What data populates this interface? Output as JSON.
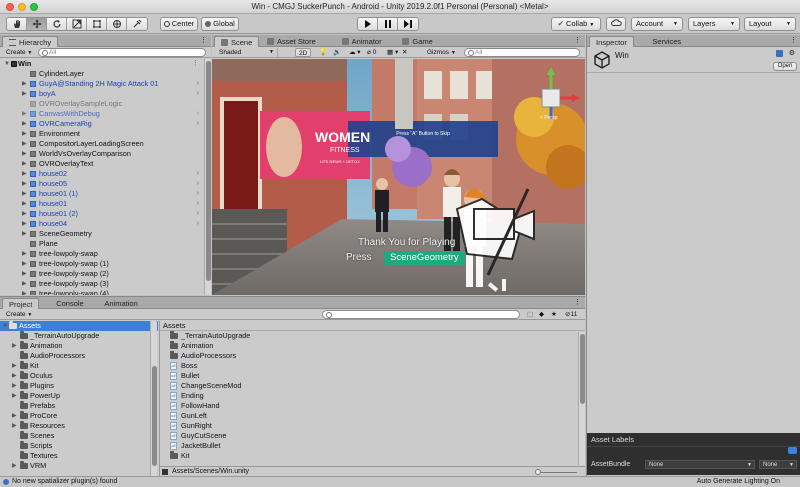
{
  "window": {
    "title": "Win - CMGJ SuckerPunch - Android - Unity 2019.2.0f1 Personal (Personal) <Metal>"
  },
  "toolbar": {
    "tools": [
      "hand-tool-icon",
      "move-tool-icon",
      "rotate-tool-icon",
      "scale-tool-icon",
      "rect-tool-icon",
      "transform-tool-icon",
      "custom-tool-icon"
    ],
    "pivot_label": "Center",
    "space_label": "Global",
    "collab_label": "Collab",
    "account_label": "Account",
    "layers_label": "Layers",
    "layout_label": "Layout"
  },
  "hierarchy": {
    "tab_label": "Hierarchy",
    "create_label": "Create",
    "search_placeholder": "All",
    "root": "Win",
    "items": [
      {
        "label": "CylinderLayer",
        "type": "normal",
        "has_children": false,
        "expand": false
      },
      {
        "label": "GuyA@Standing 2H Magic Attack 01",
        "type": "prefab",
        "has_children": true,
        "expand": true
      },
      {
        "label": "boyA",
        "type": "prefab",
        "has_children": true,
        "expand": true
      },
      {
        "label": "OVROverlaySampleLogic",
        "type": "disabled",
        "has_children": false,
        "expand": false
      },
      {
        "label": "CanvasWithDebug",
        "type": "prefab-disabled",
        "has_children": true,
        "expand": true
      },
      {
        "label": "OVRCameraRig",
        "type": "prefab",
        "has_children": true,
        "expand": true
      },
      {
        "label": "Environment",
        "type": "normal",
        "has_children": true,
        "expand": false
      },
      {
        "label": "CompositorLayerLoadingScreen",
        "type": "normal",
        "has_children": true,
        "expand": false
      },
      {
        "label": "WorldVsOverlayComparison",
        "type": "normal",
        "has_children": true,
        "expand": false
      },
      {
        "label": "OVROverlayText",
        "type": "normal",
        "has_children": true,
        "expand": false
      },
      {
        "label": "house02",
        "type": "prefab",
        "has_children": true,
        "expand": true
      },
      {
        "label": "house05",
        "type": "prefab",
        "has_children": true,
        "expand": true
      },
      {
        "label": "house01 (1)",
        "type": "prefab",
        "has_children": true,
        "expand": true
      },
      {
        "label": "house01",
        "type": "prefab",
        "has_children": true,
        "expand": true
      },
      {
        "label": "house01 (2)",
        "type": "prefab",
        "has_children": true,
        "expand": true
      },
      {
        "label": "house04",
        "type": "prefab",
        "has_children": true,
        "expand": true
      },
      {
        "label": "SceneGeometry",
        "type": "normal",
        "has_children": true,
        "expand": false
      },
      {
        "label": "Plane",
        "type": "normal",
        "has_children": false,
        "expand": false
      },
      {
        "label": "tree-lowpoly-swap",
        "type": "normal",
        "has_children": true,
        "expand": false
      },
      {
        "label": "tree-lowpoly-swap (1)",
        "type": "normal",
        "has_children": true,
        "expand": false
      },
      {
        "label": "tree-lowpoly-swap (2)",
        "type": "normal",
        "has_children": true,
        "expand": false
      },
      {
        "label": "tree-lowpoly-swap (3)",
        "type": "normal",
        "has_children": true,
        "expand": false
      },
      {
        "label": "tree-lowpoly-swap (4)",
        "type": "normal",
        "has_children": true,
        "expand": false
      }
    ]
  },
  "scene": {
    "tabs": [
      {
        "label": "Scene",
        "icon": "scene-icon",
        "active": true
      },
      {
        "label": "Asset Store",
        "icon": "store-icon",
        "active": false
      },
      {
        "label": "Animator",
        "icon": "animator-icon",
        "active": false
      },
      {
        "label": "Game",
        "icon": "game-icon",
        "active": false
      }
    ],
    "shading_mode": "Shaded",
    "mode_2d": "2D",
    "hidden_count": "0",
    "gizmos_label": "Gizmos",
    "search_placeholder": "All",
    "billboard_text": "WOMEN",
    "billboard_sub": "FITNESS",
    "billboard_small": "LIFE NEWS + DETOX",
    "overlay_panel_text": "Press \"A\" Button to Skip",
    "thank_you_text": "Thank You for Playing",
    "press_text": "Press",
    "selected_object_label": "SceneGeometry",
    "gizmo_label": "< Persp"
  },
  "inspector": {
    "tabs": [
      {
        "label": "Inspector",
        "active": true
      },
      {
        "label": "Services",
        "active": false
      }
    ],
    "object_name": "Win",
    "open_label": "Open",
    "asset_labels_title": "Asset Labels",
    "asset_bundle_label": "AssetBundle",
    "asset_bundle_value": "None",
    "asset_variant_value": "None"
  },
  "project": {
    "tabs": [
      {
        "label": "Project",
        "active": true
      },
      {
        "label": "Console",
        "active": false
      },
      {
        "label": "Animation",
        "active": false
      }
    ],
    "create_label": "Create",
    "badge_count": "11",
    "tree": [
      {
        "label": "Assets",
        "root": true,
        "selected": true,
        "has_children": true
      },
      {
        "label": "_TerrainAutoUpgrade",
        "has_children": false
      },
      {
        "label": "Animation",
        "has_children": true
      },
      {
        "label": "AudioProcessors",
        "has_children": false
      },
      {
        "label": "Kit",
        "has_children": true
      },
      {
        "label": "Oculus",
        "has_children": true
      },
      {
        "label": "Plugins",
        "has_children": true
      },
      {
        "label": "PowerUp",
        "has_children": true
      },
      {
        "label": "Prefabs",
        "has_children": false
      },
      {
        "label": "ProCore",
        "has_children": true
      },
      {
        "label": "Resources",
        "has_children": true
      },
      {
        "label": "Scenes",
        "has_children": false
      },
      {
        "label": "Scripts",
        "has_children": false
      },
      {
        "label": "Textures",
        "has_children": false
      },
      {
        "label": "VRM",
        "has_children": true
      }
    ],
    "files_header": "Assets",
    "files": [
      {
        "label": "_TerrainAutoUpgrade",
        "kind": "folder"
      },
      {
        "label": "Animation",
        "kind": "folder"
      },
      {
        "label": "AudioProcessors",
        "kind": "folder"
      },
      {
        "label": "Boss",
        "kind": "script"
      },
      {
        "label": "Bullet",
        "kind": "script"
      },
      {
        "label": "ChangeSceneMod",
        "kind": "script"
      },
      {
        "label": "Ending",
        "kind": "script"
      },
      {
        "label": "FollowHand",
        "kind": "script"
      },
      {
        "label": "GunLeft",
        "kind": "script"
      },
      {
        "label": "GunRight",
        "kind": "script"
      },
      {
        "label": "GuyCutScene",
        "kind": "script"
      },
      {
        "label": "JacketBullet",
        "kind": "script"
      },
      {
        "label": "Kit",
        "kind": "folder"
      }
    ],
    "path": "Assets/Scenes/Win.unity"
  },
  "status": {
    "message": "No new spatializer plugin(s) found",
    "lighting": "Auto Generate Lighting On"
  },
  "colors": {
    "selection": "#3e7fd6",
    "prefab_text": "#1a3fb8",
    "scene_highlight": "#1fa97e"
  }
}
